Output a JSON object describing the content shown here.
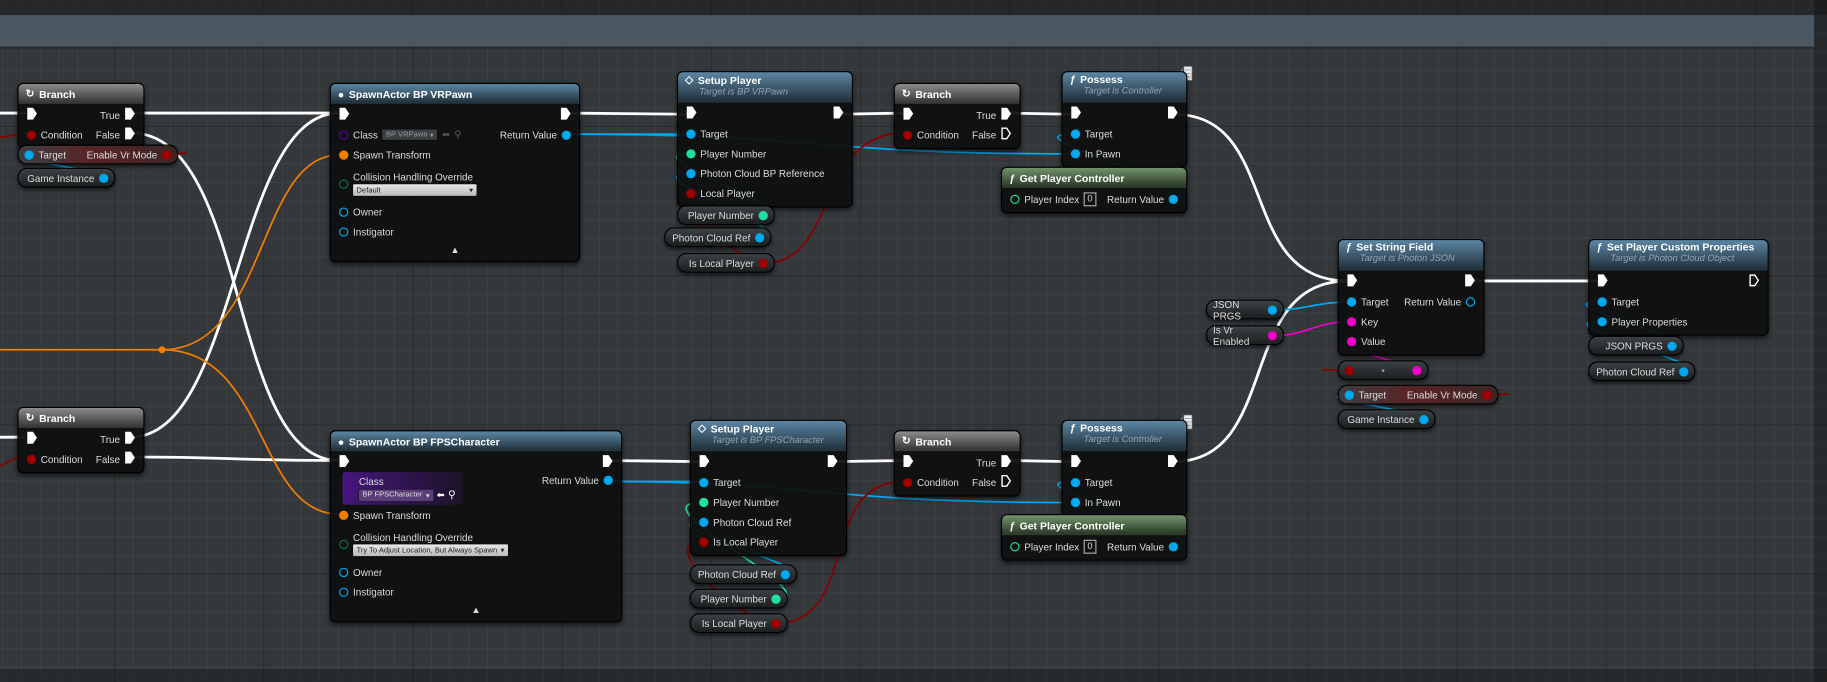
{
  "pin_colors": {
    "exec": "#ffffff",
    "bool": "#a00000",
    "object": "#00a8f0",
    "int": "#1fe0a0",
    "transform": "#f07c00",
    "string": "#f000c8",
    "class": "#5a00a8",
    "enum": "#0b6a5a"
  },
  "header_colors": {
    "branch": "#8c8c8c",
    "function": "#5c86a4",
    "pure": "#72946a"
  },
  "graph": {
    "comment_text": "",
    "nodes": [
      {
        "id": "branch_top",
        "kind": "branch",
        "icon": "branch-icon",
        "title": "Branch",
        "rows": [
          {
            "l": {
              "pin": "exec",
              "c": true
            },
            "r": {
              "label": "True",
              "pin": "exec",
              "c": true
            }
          },
          {
            "l": {
              "label": "Condition",
              "pin": "bool",
              "c": true
            },
            "r": {
              "label": "False",
              "pin": "exec",
              "c": true
            }
          }
        ]
      },
      {
        "id": "spawn_vr",
        "kind": "spawn",
        "icon": "spawn-actor-icon",
        "title": "SpawnActor BP VRPawn",
        "rows": [
          {
            "l": {
              "pin": "exec",
              "c": true
            },
            "r": {
              "pin": "exec",
              "c": true
            }
          },
          {
            "l": {
              "label": "Class",
              "pin": "class",
              "c": false,
              "widget": "class_inline",
              "value": "BP VRPawn"
            },
            "r": {
              "label": "Return Value",
              "pin": "object",
              "c": true
            }
          },
          {
            "l": {
              "label": "Spawn Transform",
              "pin": "transform",
              "c": true
            }
          },
          {
            "l": {
              "label": "Collision Handling Override",
              "pin": "enum",
              "c": false,
              "widget": "dropdown",
              "value": "Default"
            }
          },
          {
            "l": {
              "label": "Owner",
              "pin": "object",
              "c": false
            }
          },
          {
            "l": {
              "label": "Instigator",
              "pin": "object",
              "c": false
            }
          },
          {
            "collapse": "▲"
          }
        ]
      },
      {
        "id": "setup_vr",
        "kind": "func",
        "icon": "custom-event-icon",
        "title": "Setup Player",
        "subtitle": "Target is BP VRPawn",
        "rows": [
          {
            "l": {
              "pin": "exec",
              "c": true
            },
            "r": {
              "pin": "exec",
              "c": true
            }
          },
          {
            "l": {
              "label": "Target",
              "pin": "object",
              "c": true
            }
          },
          {
            "l": {
              "label": "Player Number",
              "pin": "int",
              "c": true
            }
          },
          {
            "l": {
              "label": "Photon Cloud BP Reference",
              "pin": "object",
              "c": true
            }
          },
          {
            "l": {
              "label": "Local Player",
              "pin": "bool",
              "c": true
            }
          }
        ]
      },
      {
        "id": "branch_vr",
        "kind": "branch",
        "icon": "branch-icon",
        "title": "Branch",
        "rows": [
          {
            "l": {
              "pin": "exec",
              "c": true
            },
            "r": {
              "label": "True",
              "pin": "exec",
              "c": true
            }
          },
          {
            "l": {
              "label": "Condition",
              "pin": "bool",
              "c": true
            },
            "r": {
              "label": "False",
              "pin": "exec",
              "c": false
            }
          }
        ]
      },
      {
        "id": "possess_vr",
        "kind": "func",
        "icon": "function-icon",
        "title": "Possess",
        "subtitle": "Target is Controller",
        "rows": [
          {
            "l": {
              "pin": "exec",
              "c": true
            },
            "r": {
              "pin": "exec",
              "c": true
            }
          },
          {
            "l": {
              "label": "Target",
              "pin": "object",
              "c": true
            }
          },
          {
            "l": {
              "label": "In Pawn",
              "pin": "object",
              "c": true
            }
          }
        ]
      },
      {
        "id": "gpc_vr",
        "kind": "pure",
        "icon": "function-icon",
        "title": "Get Player Controller",
        "rows": [
          {
            "l": {
              "label": "Player Index",
              "pin": "int",
              "c": false,
              "widget": "number",
              "value": "0"
            },
            "r": {
              "label": "Return Value",
              "pin": "object",
              "c": true
            }
          }
        ]
      },
      {
        "id": "set_string",
        "kind": "func",
        "icon": "function-icon",
        "title": "Set String Field",
        "subtitle": "Target is Photon JSON",
        "rows": [
          {
            "l": {
              "pin": "exec",
              "c": true
            },
            "r": {
              "pin": "exec",
              "c": true
            }
          },
          {
            "l": {
              "label": "Target",
              "pin": "object",
              "c": true
            },
            "r": {
              "label": "Return Value",
              "pin": "object",
              "c": false
            }
          },
          {
            "l": {
              "label": "Key",
              "pin": "string",
              "c": true
            }
          },
          {
            "l": {
              "label": "Value",
              "pin": "string",
              "c": true
            }
          }
        ]
      },
      {
        "id": "set_props",
        "kind": "func",
        "icon": "function-icon",
        "title": "Set Player Custom Properties",
        "subtitle": "Target is Photon Cloud Object",
        "rows": [
          {
            "l": {
              "pin": "exec",
              "c": true
            },
            "r": {
              "pin": "exec",
              "c": false
            }
          },
          {
            "l": {
              "label": "Target",
              "pin": "object",
              "c": true
            }
          },
          {
            "l": {
              "label": "Player Properties",
              "pin": "object",
              "c": true
            }
          }
        ]
      },
      {
        "id": "branch_bottom",
        "kind": "branch",
        "icon": "branch-icon",
        "title": "Branch",
        "rows": [
          {
            "l": {
              "pin": "exec",
              "c": true
            },
            "r": {
              "label": "True",
              "pin": "exec",
              "c": true
            }
          },
          {
            "l": {
              "label": "Condition",
              "pin": "bool",
              "c": true
            },
            "r": {
              "label": "False",
              "pin": "exec",
              "c": true
            }
          }
        ]
      },
      {
        "id": "spawn_fps",
        "kind": "spawn",
        "icon": "spawn-actor-icon",
        "title": "SpawnActor BP FPSCharacter",
        "rows": [
          {
            "l": {
              "pin": "exec",
              "c": true
            },
            "r": {
              "pin": "exec",
              "c": true
            }
          },
          {
            "l": {
              "label": "Class",
              "pin": "class",
              "c": false,
              "widget": "class_block",
              "value": "BP FPSCharacter"
            },
            "r": {
              "label": "Return Value",
              "pin": "object",
              "c": true
            }
          },
          {
            "l": {
              "label": "Spawn Transform",
              "pin": "transform",
              "c": true
            }
          },
          {
            "l": {
              "label": "Collision Handling Override",
              "pin": "enum",
              "c": false,
              "widget": "dropdown",
              "value": "Try To Adjust Location, But Always Spawn"
            }
          },
          {
            "l": {
              "label": "Owner",
              "pin": "object",
              "c": false
            }
          },
          {
            "l": {
              "label": "Instigator",
              "pin": "object",
              "c": false
            }
          },
          {
            "collapse": "▲"
          }
        ]
      },
      {
        "id": "setup_fps",
        "kind": "func",
        "icon": "custom-event-icon",
        "title": "Setup Player",
        "subtitle": "Target is BP FPSCharacter",
        "rows": [
          {
            "l": {
              "pin": "exec",
              "c": true
            },
            "r": {
              "pin": "exec",
              "c": true
            }
          },
          {
            "l": {
              "label": "Target",
              "pin": "object",
              "c": true
            }
          },
          {
            "l": {
              "label": "Player Number",
              "pin": "int",
              "c": true
            }
          },
          {
            "l": {
              "label": "Photon Cloud Ref",
              "pin": "object",
              "c": true
            }
          },
          {
            "l": {
              "label": "Is Local Player",
              "pin": "bool",
              "c": true
            }
          }
        ]
      },
      {
        "id": "branch_fps",
        "kind": "branch",
        "icon": "branch-icon",
        "title": "Branch",
        "rows": [
          {
            "l": {
              "pin": "exec",
              "c": true
            },
            "r": {
              "label": "True",
              "pin": "exec",
              "c": true
            }
          },
          {
            "l": {
              "label": "Condition",
              "pin": "bool",
              "c": true
            },
            "r": {
              "label": "False",
              "pin": "exec",
              "c": false
            }
          }
        ]
      },
      {
        "id": "possess_fps",
        "kind": "func",
        "icon": "function-icon",
        "title": "Possess",
        "subtitle": "Target is Controller",
        "rows": [
          {
            "l": {
              "pin": "exec",
              "c": true
            },
            "r": {
              "pin": "exec",
              "c": true
            }
          },
          {
            "l": {
              "label": "Target",
              "pin": "object",
              "c": true
            }
          },
          {
            "l": {
              "label": "In Pawn",
              "pin": "object",
              "c": true
            }
          }
        ]
      },
      {
        "id": "gpc_fps",
        "kind": "pure",
        "icon": "function-icon",
        "title": "Get Player Controller",
        "rows": [
          {
            "l": {
              "label": "Player Index",
              "pin": "int",
              "c": false,
              "widget": "number",
              "value": "0"
            },
            "r": {
              "label": "Return Value",
              "pin": "object",
              "c": true
            }
          }
        ]
      }
    ],
    "variables": [
      {
        "id": "setter_top",
        "kind": "setter",
        "left_label": "Target",
        "left_pin": "object",
        "label": "Enable Vr Mode",
        "pin": "bool"
      },
      {
        "id": "gi_top",
        "kind": "getter",
        "label": "Game Instance",
        "pin": "object"
      },
      {
        "id": "vr_pn",
        "kind": "getter",
        "label": "Player Number",
        "pin": "int"
      },
      {
        "id": "vr_pcr",
        "kind": "getter",
        "label": "Photon Cloud Ref",
        "pin": "object"
      },
      {
        "id": "vr_ilp",
        "kind": "getter",
        "label": "Is Local Player",
        "pin": "bool"
      },
      {
        "id": "json1",
        "kind": "getter",
        "label": "JSON PRGS",
        "pin": "object"
      },
      {
        "id": "isvr",
        "kind": "getter",
        "label": "Is Vr Enabled",
        "pin": "string"
      },
      {
        "id": "conv",
        "kind": "convert",
        "label": "•",
        "left_pin": "bool",
        "pin": "string"
      },
      {
        "id": "setter_right",
        "kind": "setter",
        "left_label": "Target",
        "left_pin": "object",
        "label": "Enable Vr Mode",
        "pin": "bool"
      },
      {
        "id": "gi_right",
        "kind": "getter",
        "label": "Game Instance",
        "pin": "object"
      },
      {
        "id": "json2",
        "kind": "getter",
        "label": "JSON PRGS",
        "pin": "object"
      },
      {
        "id": "pcr2",
        "kind": "getter",
        "label": "Photon Cloud Ref",
        "pin": "object"
      },
      {
        "id": "fps_pcr",
        "kind": "getter",
        "label": "Photon Cloud Ref",
        "pin": "object"
      },
      {
        "id": "fps_pn",
        "kind": "getter",
        "label": "Player Number",
        "pin": "int"
      },
      {
        "id": "fps_ilp",
        "kind": "getter",
        "label": "Is Local Player",
        "pin": "bool"
      }
    ]
  }
}
